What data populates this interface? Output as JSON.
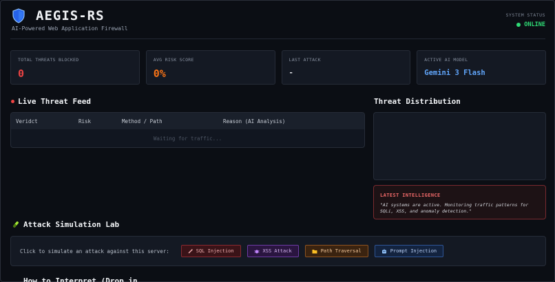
{
  "app": {
    "title": "AEGIS-RS",
    "tagline": "AI-Powered Web Application Firewall",
    "status_label": "SYSTEM STATUS",
    "status_value": "ONLINE"
  },
  "stats": [
    {
      "label": "TOTAL THREATS BLOCKED",
      "value": "0",
      "color": "#ef4444"
    },
    {
      "label": "AVG RISK SCORE",
      "value": "0%",
      "color": "#f97316"
    },
    {
      "label": "LAST ATTACK",
      "value": "-",
      "color": "#e6e8ec"
    },
    {
      "label": "ACTIVE AI MODEL",
      "value": "Gemini 3 Flash",
      "color": "#60a5fa"
    }
  ],
  "feed": {
    "title": "Live Threat Feed",
    "columns": [
      "Veridct",
      "Risk",
      "Method / Path",
      "Reason (AI Analysis)"
    ],
    "empty_text": "Waiting for traffic..."
  },
  "distribution": {
    "title": "Threat Distribution"
  },
  "intel": {
    "title": "LATEST INTELLIGENCE",
    "text": "\"AI systems are active. Monitoring traffic patterns for SQLi, XSS, and anomaly detection.\""
  },
  "lab": {
    "title": "Attack Simulation Lab",
    "prompt": "Click to simulate an attack against this server:",
    "buttons": [
      {
        "label": "SQL Injection",
        "icon": "syringe-icon"
      },
      {
        "label": "XSS Attack",
        "icon": "bug-icon"
      },
      {
        "label": "Path Traversal",
        "icon": "folder-icon"
      },
      {
        "label": "Prompt Injection",
        "icon": "robot-icon"
      }
    ]
  },
  "next_section": {
    "title": "How to Interpret (Drop in"
  },
  "colors": {
    "accent_blue": "#60a5fa",
    "online_green": "#2fdc76",
    "danger_red": "#ef4444"
  }
}
